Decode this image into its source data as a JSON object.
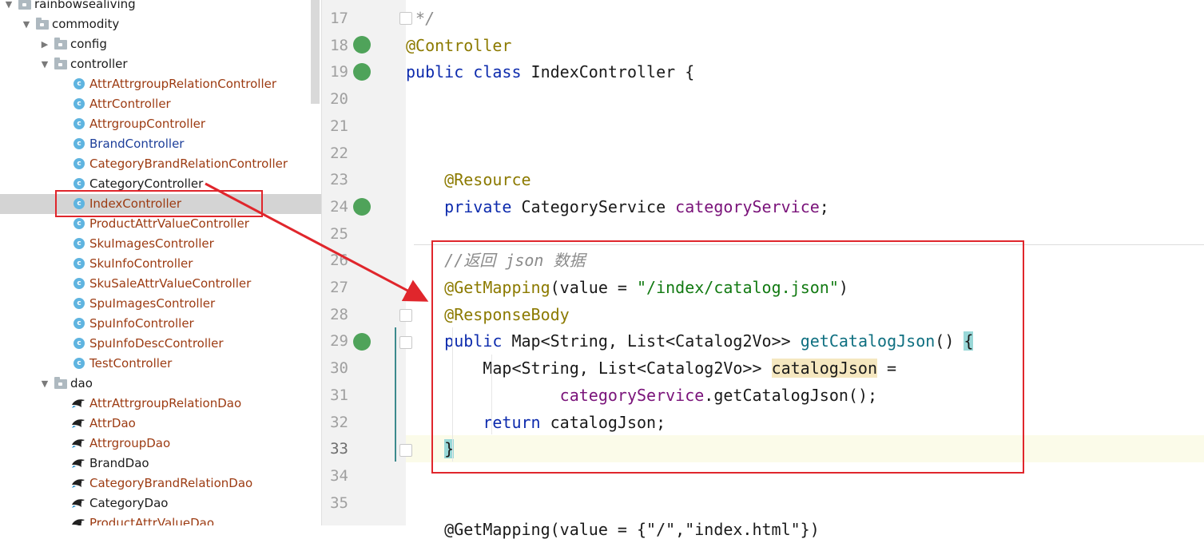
{
  "tree": {
    "items": [
      {
        "label": "rainbowsealiving",
        "type": "folder",
        "depth": 0,
        "expanded": true,
        "color": "text"
      },
      {
        "label": "commodity",
        "type": "folder",
        "depth": 1,
        "expanded": true,
        "color": "text"
      },
      {
        "label": "config",
        "type": "folder",
        "depth": 2,
        "expanded": false,
        "color": "text"
      },
      {
        "label": "controller",
        "type": "folder",
        "depth": 2,
        "expanded": true,
        "color": "text"
      },
      {
        "label": "AttrAttrgroupRelationController",
        "type": "class",
        "depth": 3,
        "color": "mod"
      },
      {
        "label": "AttrController",
        "type": "class",
        "depth": 3,
        "color": "mod"
      },
      {
        "label": "AttrgroupController",
        "type": "class",
        "depth": 3,
        "color": "mod"
      },
      {
        "label": "BrandController",
        "type": "class",
        "depth": 3,
        "color": "blue"
      },
      {
        "label": "CategoryBrandRelationController",
        "type": "class",
        "depth": 3,
        "color": "mod"
      },
      {
        "label": "CategoryController",
        "type": "class",
        "depth": 3,
        "color": "text"
      },
      {
        "label": "IndexController",
        "type": "class",
        "depth": 3,
        "color": "mod",
        "selected": true
      },
      {
        "label": "ProductAttrValueController",
        "type": "class",
        "depth": 3,
        "color": "mod"
      },
      {
        "label": "SkuImagesController",
        "type": "class",
        "depth": 3,
        "color": "mod"
      },
      {
        "label": "SkuInfoController",
        "type": "class",
        "depth": 3,
        "color": "mod"
      },
      {
        "label": "SkuSaleAttrValueController",
        "type": "class",
        "depth": 3,
        "color": "mod"
      },
      {
        "label": "SpuImagesController",
        "type": "class",
        "depth": 3,
        "color": "mod"
      },
      {
        "label": "SpuInfoController",
        "type": "class",
        "depth": 3,
        "color": "mod"
      },
      {
        "label": "SpuInfoDescController",
        "type": "class",
        "depth": 3,
        "color": "mod"
      },
      {
        "label": "TestController",
        "type": "class",
        "depth": 3,
        "color": "mod"
      },
      {
        "label": "dao",
        "type": "folder",
        "depth": 2,
        "expanded": true,
        "color": "text"
      },
      {
        "label": "AttrAttrgroupRelationDao",
        "type": "dao",
        "depth": 3,
        "color": "mod"
      },
      {
        "label": "AttrDao",
        "type": "dao",
        "depth": 3,
        "color": "mod"
      },
      {
        "label": "AttrgroupDao",
        "type": "dao",
        "depth": 3,
        "color": "mod"
      },
      {
        "label": "BrandDao",
        "type": "dao",
        "depth": 3,
        "color": "text"
      },
      {
        "label": "CategoryBrandRelationDao",
        "type": "dao",
        "depth": 3,
        "color": "mod"
      },
      {
        "label": "CategoryDao",
        "type": "dao",
        "depth": 3,
        "color": "text"
      },
      {
        "label": "ProductAttrValueDao",
        "type": "dao",
        "depth": 3,
        "color": "mod"
      }
    ]
  },
  "editor": {
    "current_line": "33",
    "lines": [
      {
        "num": "17",
        "tokens": [
          {
            "t": " */",
            "c": "cmt"
          }
        ]
      },
      {
        "num": "18",
        "tokens": [
          {
            "t": "@Controller",
            "c": "ann"
          }
        ]
      },
      {
        "num": "19",
        "tokens": [
          {
            "t": "public class ",
            "c": "kw"
          },
          {
            "t": "IndexController {",
            "c": ""
          }
        ]
      },
      {
        "num": "20",
        "tokens": []
      },
      {
        "num": "21",
        "tokens": []
      },
      {
        "num": "22",
        "tokens": []
      },
      {
        "num": "23",
        "tokens": [
          {
            "t": "    ",
            "c": ""
          },
          {
            "t": "@Resource",
            "c": "ann"
          }
        ]
      },
      {
        "num": "24",
        "tokens": [
          {
            "t": "    ",
            "c": ""
          },
          {
            "t": "private ",
            "c": "kw"
          },
          {
            "t": "CategoryService ",
            "c": ""
          },
          {
            "t": "categoryService",
            "c": "fld"
          },
          {
            "t": ";",
            "c": ""
          }
        ]
      },
      {
        "num": "25",
        "tokens": []
      },
      {
        "num": "26",
        "tokens": [
          {
            "t": "    ",
            "c": ""
          },
          {
            "t": "//返回 json 数据",
            "c": "cmt"
          }
        ]
      },
      {
        "num": "27",
        "tokens": [
          {
            "t": "    ",
            "c": ""
          },
          {
            "t": "@GetMapping",
            "c": "ann"
          },
          {
            "t": "(value = ",
            "c": ""
          },
          {
            "t": "\"/index/catalog.json\"",
            "c": "str"
          },
          {
            "t": ")",
            "c": ""
          }
        ]
      },
      {
        "num": "28",
        "tokens": [
          {
            "t": "    ",
            "c": ""
          },
          {
            "t": "@ResponseBody",
            "c": "ann"
          }
        ]
      },
      {
        "num": "29",
        "tokens": [
          {
            "t": "    ",
            "c": ""
          },
          {
            "t": "public ",
            "c": "kw"
          },
          {
            "t": "Map<String, List<Catalog2Vo>> ",
            "c": ""
          },
          {
            "t": "getCatalogJson",
            "c": "mth"
          },
          {
            "t": "() ",
            "c": ""
          },
          {
            "t": "{",
            "c": "hl-brace"
          }
        ]
      },
      {
        "num": "30",
        "tokens": [
          {
            "t": "        ",
            "c": ""
          },
          {
            "t": "Map<String, List<Catalog2Vo>> ",
            "c": ""
          },
          {
            "t": "catalogJson",
            "c": "hl-var"
          },
          {
            "t": " =",
            "c": ""
          }
        ]
      },
      {
        "num": "31",
        "tokens": [
          {
            "t": "                ",
            "c": ""
          },
          {
            "t": "categoryService",
            "c": "fld"
          },
          {
            "t": ".getCatalogJson();",
            "c": ""
          }
        ]
      },
      {
        "num": "32",
        "tokens": [
          {
            "t": "        ",
            "c": ""
          },
          {
            "t": "return ",
            "c": "kw"
          },
          {
            "t": "catalogJson;",
            "c": ""
          }
        ]
      },
      {
        "num": "33",
        "tokens": [
          {
            "t": "    ",
            "c": ""
          },
          {
            "t": "}",
            "c": "hl-brace"
          }
        ]
      },
      {
        "num": "34",
        "tokens": []
      },
      {
        "num": "35",
        "tokens": []
      }
    ],
    "partial_next_line": "    @GetMapping(value = {\"/\",\"index.html\"})"
  },
  "colors": {
    "annotation_red": "#e0262c",
    "keyword": "#0d2bad",
    "annotation": "#8c7a00",
    "string": "#127a12",
    "field": "#7a137a",
    "method": "#0e6f80",
    "comment": "#8b8b8b",
    "modified_file": "#9c3b12"
  }
}
